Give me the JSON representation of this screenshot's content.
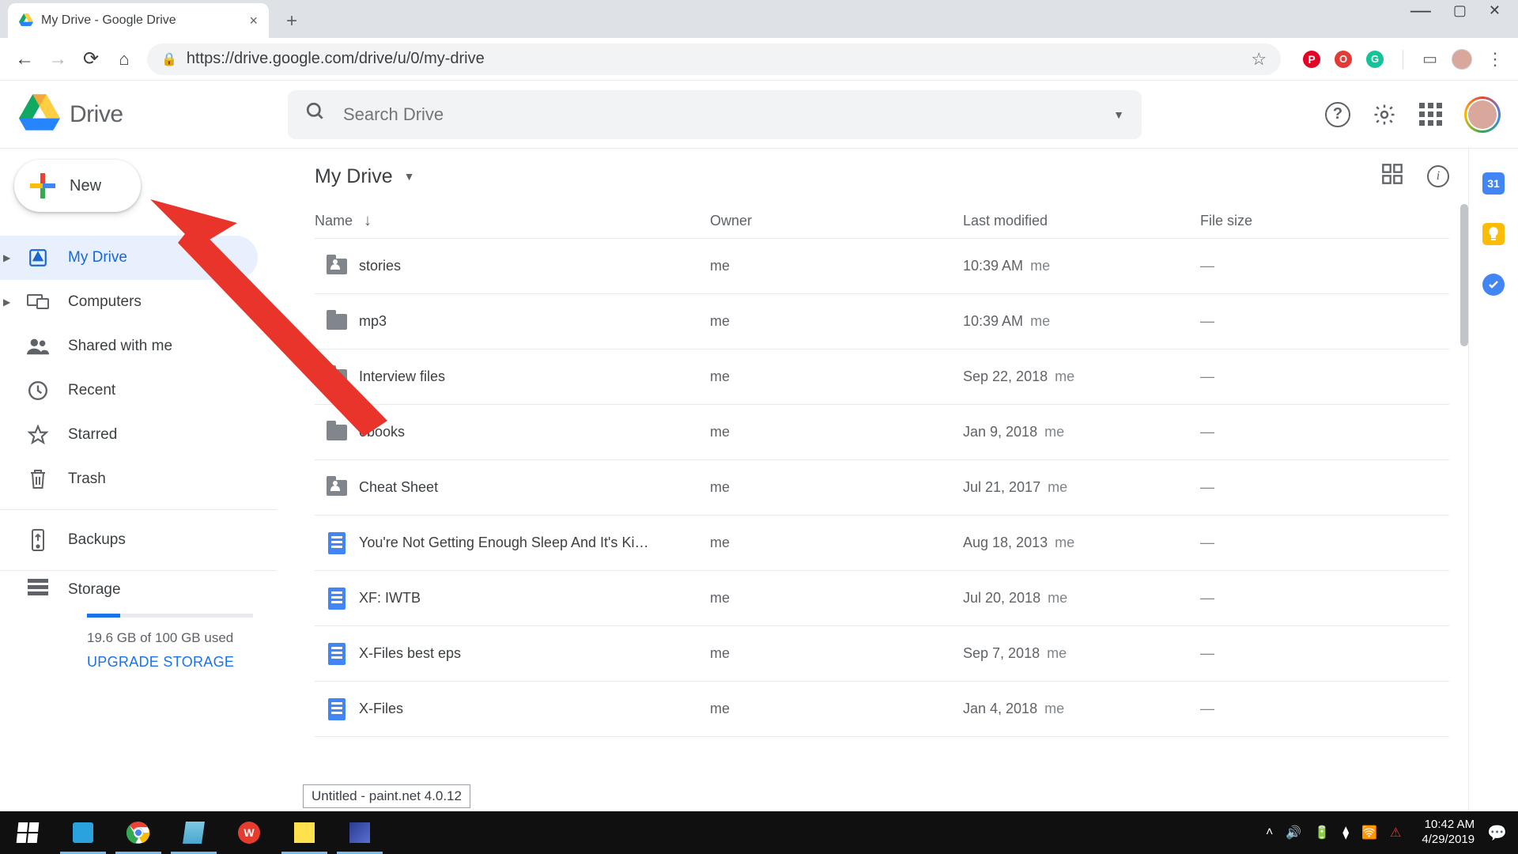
{
  "browser": {
    "tab_title": "My Drive - Google Drive",
    "url": "https://drive.google.com/drive/u/0/my-drive"
  },
  "header": {
    "product_name": "Drive",
    "search_placeholder": "Search Drive"
  },
  "sidebar": {
    "new_label": "New",
    "items": [
      {
        "label": "My Drive",
        "active": true,
        "has_caret": true
      },
      {
        "label": "Computers",
        "has_caret": true
      },
      {
        "label": "Shared with me"
      },
      {
        "label": "Recent"
      },
      {
        "label": "Starred"
      },
      {
        "label": "Trash"
      }
    ],
    "backups_label": "Backups",
    "storage_label": "Storage",
    "storage_used_text": "19.6 GB of 100 GB used",
    "upgrade_label": "UPGRADE STORAGE"
  },
  "main": {
    "path_label": "My Drive",
    "columns": {
      "name": "Name",
      "owner": "Owner",
      "modified": "Last modified",
      "size": "File size"
    },
    "rows": [
      {
        "type": "folder-shared",
        "name": "stories",
        "owner": "me",
        "modified": "10:39 AM",
        "mod_by": "me",
        "size": "—"
      },
      {
        "type": "folder",
        "name": "mp3",
        "owner": "me",
        "modified": "10:39 AM",
        "mod_by": "me",
        "size": "—"
      },
      {
        "type": "folder-shared",
        "name": "Interview files",
        "owner": "me",
        "modified": "Sep 22, 2018",
        "mod_by": "me",
        "size": "—"
      },
      {
        "type": "folder",
        "name": "ebooks",
        "owner": "me",
        "modified": "Jan 9, 2018",
        "mod_by": "me",
        "size": "—"
      },
      {
        "type": "folder-shared",
        "name": "Cheat Sheet",
        "owner": "me",
        "modified": "Jul 21, 2017",
        "mod_by": "me",
        "size": "—"
      },
      {
        "type": "doc",
        "name": "You're Not Getting Enough Sleep And It's Ki…",
        "owner": "me",
        "modified": "Aug 18, 2013",
        "mod_by": "me",
        "size": "—"
      },
      {
        "type": "doc",
        "name": "XF: IWTB",
        "owner": "me",
        "modified": "Jul 20, 2018",
        "mod_by": "me",
        "size": "—"
      },
      {
        "type": "doc",
        "name": "X-Files best eps",
        "owner": "me",
        "modified": "Sep 7, 2018",
        "mod_by": "me",
        "size": "—"
      },
      {
        "type": "doc",
        "name": "X-Files",
        "owner": "me",
        "modified": "Jan 4, 2018",
        "mod_by": "me",
        "size": "—"
      }
    ]
  },
  "tooltip_text": "Untitled - paint.net 4.0.12",
  "taskbar": {
    "time": "10:42 AM",
    "date": "4/29/2019"
  },
  "colors": {
    "accent_blue": "#1a73e8",
    "active_bg": "#e8f0fe",
    "grey_text": "#5f6368",
    "annotation_red": "#e8342a"
  }
}
